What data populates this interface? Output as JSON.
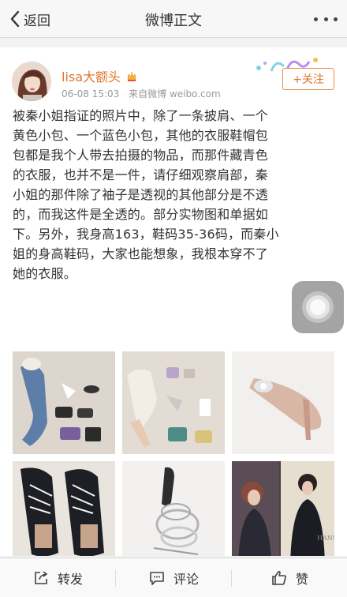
{
  "nav": {
    "back_label": "返回",
    "title": "微博正文"
  },
  "post": {
    "username": "lisa大额头",
    "date": "06-08 15:03",
    "source": "来自微博 weibo.com",
    "follow_label": "+关注",
    "text": "被秦小姐指证的照片中，除了一条披肩、一个\n黄色小包、一个蓝色小包，其他的衣服鞋帽包\n包都是我个人带去拍摄的物品，而那件藏青色\n的衣服，也并不是一件，请仔细观察肩部，秦\n小姐的那件除了袖子是透视的其他部分是不透\n的，而我这件是全透的。部分实物图和单据如\n下。另外，我身高163，鞋码35-36码，而秦小\n姐的身高鞋码，大家也能想象，我根本穿不了\n她的衣服。",
    "photo_captions": [
      "HANS"
    ]
  },
  "actions": {
    "repost_label": "转发",
    "comment_label": "评论",
    "like_label": "赞"
  },
  "colors": {
    "accent": "#e0742c",
    "nav_bg": "#f7f7f7"
  },
  "icons": [
    "chevron-left-icon",
    "more-dots-icon",
    "vip-crown-icon",
    "repost-icon",
    "comment-icon",
    "like-icon"
  ]
}
